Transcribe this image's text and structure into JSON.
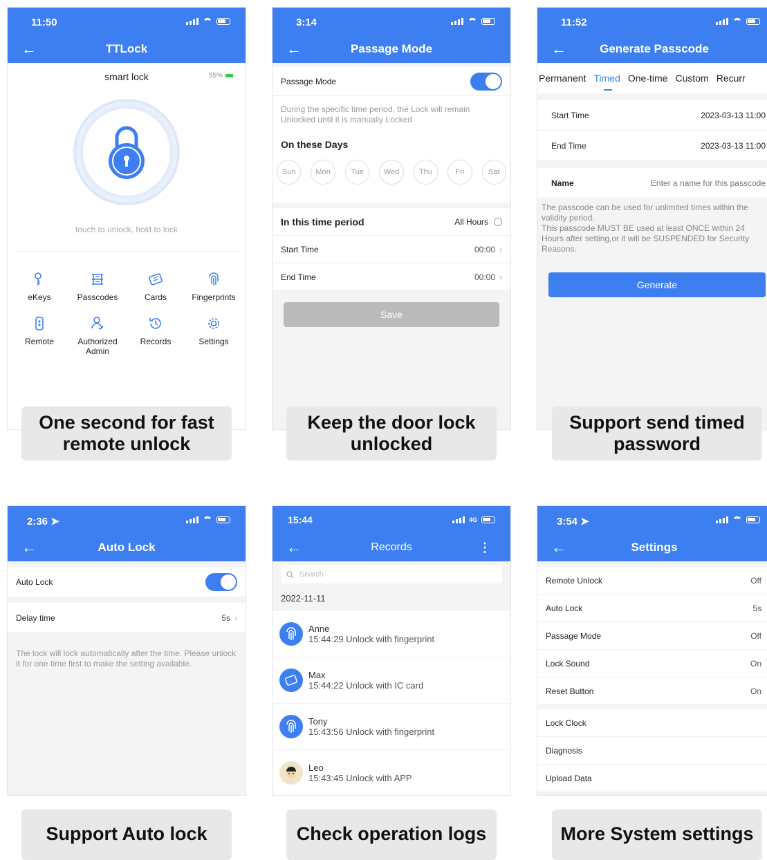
{
  "colors": {
    "accent": "#3d7ff0"
  },
  "p1": {
    "time": "11:50",
    "title": "TTLock",
    "lock_name": "smart lock",
    "battery": "55%",
    "hint": "touch to unlock, hold to lock",
    "features": [
      {
        "label": "eKeys",
        "icon": "ekey-icon"
      },
      {
        "label": "Passcodes",
        "icon": "passcodes-icon"
      },
      {
        "label": "Cards",
        "icon": "cards-icon"
      },
      {
        "label": "Fingerprints",
        "icon": "fingerprint-icon"
      },
      {
        "label": "Remote",
        "icon": "remote-icon"
      },
      {
        "label": "Authorized Admin",
        "icon": "admin-icon"
      },
      {
        "label": "Records",
        "icon": "records-icon"
      },
      {
        "label": "Settings",
        "icon": "settings-icon"
      }
    ],
    "caption": "One second for fast remote unlock"
  },
  "p2": {
    "time": "3:14",
    "title": "Passage Mode",
    "mode_label": "Passage Mode",
    "note": "During the specific time period, the Lock will remain Unlocked until it is manually Locked",
    "days_title": "On these Days",
    "days": [
      "Sun",
      "Mon",
      "Tue",
      "Wed",
      "Thu",
      "Fri",
      "Sat"
    ],
    "period_label": "In this time period",
    "all_hours": "All Hours",
    "start_label": "Start Time",
    "start_value": "00:00",
    "end_label": "End Time",
    "end_value": "00:00",
    "save": "Save",
    "caption": "Keep the door lock unlocked"
  },
  "p3": {
    "time": "11:52",
    "title": "Generate Passcode",
    "tabs": [
      "Permanent",
      "Timed",
      "One-time",
      "Custom",
      "Recurr"
    ],
    "start_label": "Start Time",
    "start_value": "2023-03-13 11:00",
    "end_label": "End Time",
    "end_value": "2023-03-13 11:00",
    "name_label": "Name",
    "name_placeholder": "Enter a name for this passcode",
    "note": "The passcode can be used for unlimited times within the validity period.\nThis passcode MUST BE used at least ONCE within 24 Hours after setting,or it will be SUSPENDED for Security Reasons.",
    "generate": "Generate",
    "caption": "Support send timed password"
  },
  "p4": {
    "time": "2:36",
    "title": "Auto Lock",
    "auto_label": "Auto Lock",
    "delay_label": "Delay time",
    "delay_value": "5s",
    "note": "The lock will lock automatically after the time. Please unlock it for one time first to make the setting available.",
    "caption": "Support Auto lock"
  },
  "p5": {
    "time": "15:44",
    "network": "4G",
    "title": "Records",
    "search_placeholder": "Search",
    "date": "2022-11-11",
    "records": [
      {
        "name": "Anne",
        "desc": "15:44:29 Unlock with fingerprint"
      },
      {
        "name": "Max",
        "desc": "15:44:22 Unlock with IC card"
      },
      {
        "name": "Tony",
        "desc": "15:43:56 Unlock with fingerprint"
      },
      {
        "name": "Leo",
        "desc": "15:43:45 Unlock with APP"
      }
    ],
    "caption": "Check operation logs"
  },
  "p6": {
    "time": "3:54",
    "title": "Settings",
    "rows": [
      {
        "label": "Remote Unlock",
        "value": "Off"
      },
      {
        "label": "Auto Lock",
        "value": "5s"
      },
      {
        "label": "Passage Mode",
        "value": "Off"
      },
      {
        "label": "Lock Sound",
        "value": "On"
      },
      {
        "label": "Reset Button",
        "value": "On"
      }
    ],
    "rows2": [
      "Lock Clock",
      "Diagnosis",
      "Upload Data"
    ],
    "caption": "More System settings"
  }
}
